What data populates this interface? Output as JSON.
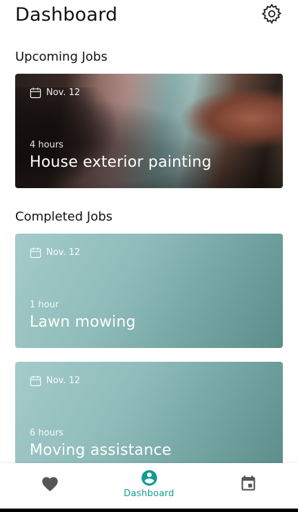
{
  "header": {
    "title": "Dashboard",
    "settings_icon": "gear-icon"
  },
  "sections": {
    "upcoming": "Upcoming Jobs",
    "completed": "Completed Jobs"
  },
  "upcoming_jobs": [
    {
      "date": "Nov. 12",
      "hours": "4 hours",
      "name": "House exterior painting"
    }
  ],
  "completed_jobs": [
    {
      "date": "Nov. 12",
      "hours": "1 hour",
      "name": "Lawn mowing"
    },
    {
      "date": "Nov. 12",
      "hours": "6 hours",
      "name": "Moving assistance"
    }
  ],
  "bottom_nav": {
    "items": [
      {
        "icon": "heart-icon",
        "label": ""
      },
      {
        "icon": "account-circle-icon",
        "label": "Dashboard",
        "active": true
      },
      {
        "icon": "calendar-icon",
        "label": ""
      }
    ]
  },
  "colors": {
    "accent": "#129b8e",
    "card_teal": "#8fbcba"
  }
}
